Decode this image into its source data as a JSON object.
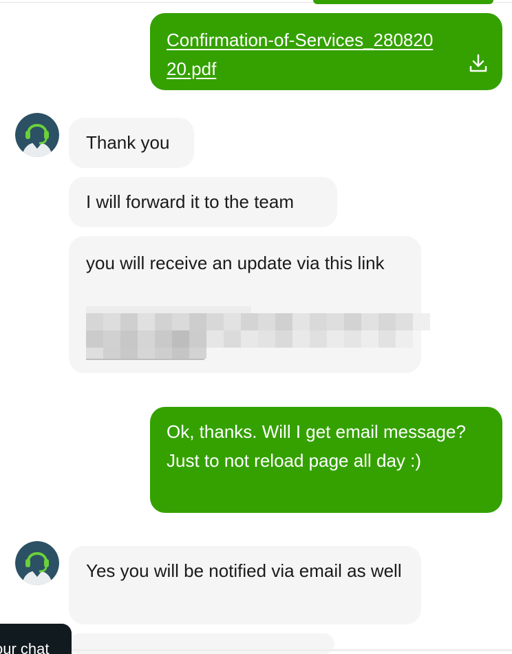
{
  "colors": {
    "user_bubble": "#34a100",
    "agent_bubble": "#f5f5f5",
    "avatar_bg": "#2c5064",
    "headset": "#6ad13a"
  },
  "messages": {
    "file": {
      "name": "Confirmation-of-Services_28082020.pdf",
      "icon": "download-icon"
    },
    "m1": "Thank you",
    "m2": "I will forward it to the team",
    "m3": "you will receive an update via this link",
    "m4": "Ok, thanks. Will I get email message? Just to not reload page all day :)",
    "m5": "Yes you will be notified via email as well"
  },
  "avatar": {
    "icon": "support-agent-icon"
  },
  "chat_tab": {
    "label": "our chat"
  }
}
